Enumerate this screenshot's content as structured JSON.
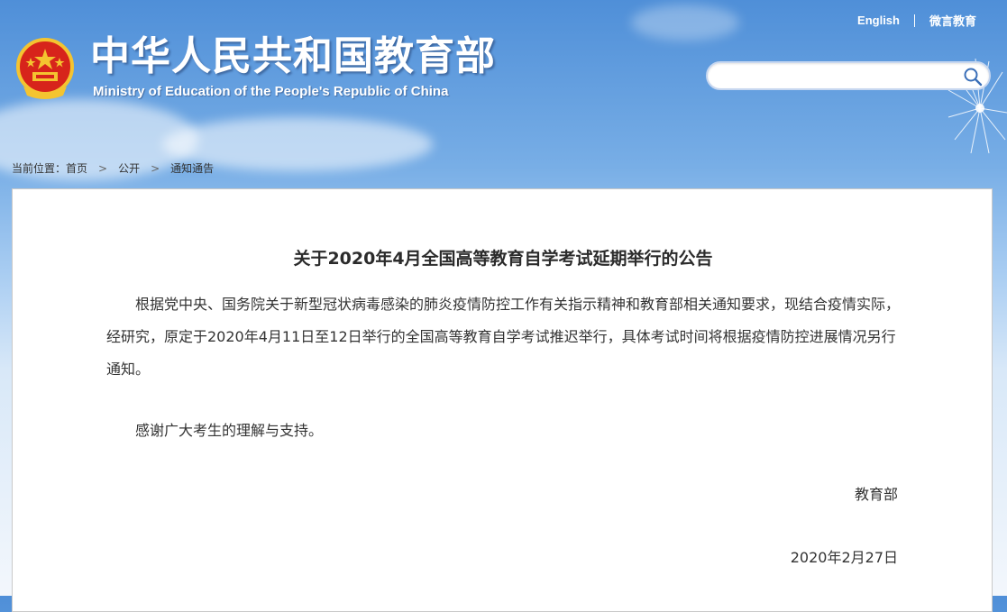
{
  "header": {
    "site_title": "中华人民共和国教育部",
    "site_subtitle": "Ministry of Education of the People's Republic of China",
    "links": {
      "english": "English",
      "weibo": "微言教育"
    },
    "search": {
      "value": "",
      "placeholder": ""
    }
  },
  "breadcrumb": {
    "prefix": "当前位置：",
    "items": [
      "首页",
      "公开",
      "通知通告"
    ],
    "separator": ">"
  },
  "article": {
    "title": "关于2020年4月全国高等教育自学考试延期举行的公告",
    "paragraphs": [
      "根据党中央、国务院关于新型冠状病毒感染的肺炎疫情防控工作有关指示精神和教育部相关通知要求，现结合疫情实际，经研究，原定于2020年4月11日至12日举行的全国高等教育自学考试推迟举行，具体考试时间将根据疫情防控进展情况另行通知。",
      "感谢广大考生的理解与支持。"
    ],
    "signature": "教育部",
    "date": "2020年2月27日"
  },
  "colors": {
    "sky_top": "#4f8fd8",
    "emblem_red": "#d7241b",
    "emblem_gold": "#f4c430",
    "text": "#333333"
  },
  "icons": [
    "national-emblem-icon",
    "search-icon",
    "dandelion-decoration"
  ]
}
